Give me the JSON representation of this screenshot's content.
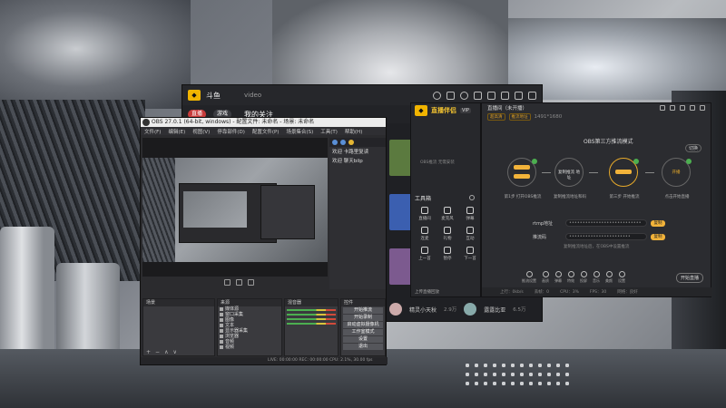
{
  "bg_app": {
    "name": "斗鱼",
    "url_text": "video",
    "nav_pills": [
      "直播",
      "游戏"
    ],
    "nav_title": "我的关注",
    "bottom_user": "精灵小天秋",
    "bottom_user2": "露露比亚",
    "bottom_views": "2.9万",
    "bottom_views2": "6.5万"
  },
  "obs": {
    "title": "OBS 27.0.1 (64-bit, windows) - 配置文件: 未命名 - 场景: 未命名",
    "menu": [
      "文件(F)",
      "编辑(E)",
      "视图(V)",
      "停靠部件(D)",
      "配置文件(P)",
      "场景集合(S)",
      "工具(T)",
      "帮助(H)"
    ],
    "chat_lines": [
      "欢迎  卡路里复读",
      "欢迎  聊天bilp"
    ],
    "docks": {
      "scenes_header": "场景",
      "sources_header": "来源",
      "mixer_header": "混音器",
      "transitions_header": "转场特效",
      "controls_header": "控件",
      "sources": [
        "媒体源",
        "窗口采集",
        "图像",
        "文本",
        "显示器采集",
        "浏览器",
        "音频",
        "视频"
      ],
      "mixer_track_value": "300 ms",
      "controls": [
        "开始推流",
        "开始录制",
        "启动虚拟摄像机",
        "工作室模式",
        "设置",
        "退出"
      ],
      "foot_symbols": [
        "+",
        "−",
        "∧",
        "∨"
      ]
    },
    "status": "LIVE: 00:00:00   REC: 00:00:00   CPU: 2.1%, 30.00 fps"
  },
  "assistant": {
    "name": "直播伴侣",
    "vip": "VIP",
    "hint": "OBS推流  无需安装",
    "tools_title": "工具箱",
    "tools": [
      "直播间",
      "麦克风",
      "弹幕",
      "连麦",
      "礼物",
      "互动",
      "上一首",
      "暂停",
      "下一首"
    ],
    "upload": "上传直播回放"
  },
  "dialog": {
    "room": "直播间（未开播）",
    "chips": [
      "超高清",
      "推流地址"
    ],
    "size": "1491*1680",
    "mode_title": "OBS第三方推流模式",
    "switch": "切换",
    "steps": [
      {
        "label": "推流",
        "sub": "第1步 打开OBS推流"
      },
      {
        "label": "复制推流 地址",
        "sub": "复制推流地址和码"
      },
      {
        "label": "开始推流",
        "sub": "第三步 开始推流"
      },
      {
        "label": "开播",
        "sub": "点击开始直播"
      }
    ],
    "fields": [
      {
        "label": "rtmp地址",
        "value": "•••••••••••••••••••••••••••",
        "btn": "复制"
      },
      {
        "label": "推流码",
        "value": "•••••••••••••••••••••••",
        "btn": "复制"
      }
    ],
    "note": "复制推流地址后，在OBS中设置推流",
    "bottom": [
      "推流设置",
      "画质",
      "弹幕",
      "特效",
      "投屏",
      "音乐",
      "美颜",
      "设置"
    ],
    "start": "开始直播",
    "footer": [
      "上行：0kb/s",
      "丢帧：0",
      "CPU：3%",
      "FPS：30",
      "网络：良好"
    ]
  }
}
